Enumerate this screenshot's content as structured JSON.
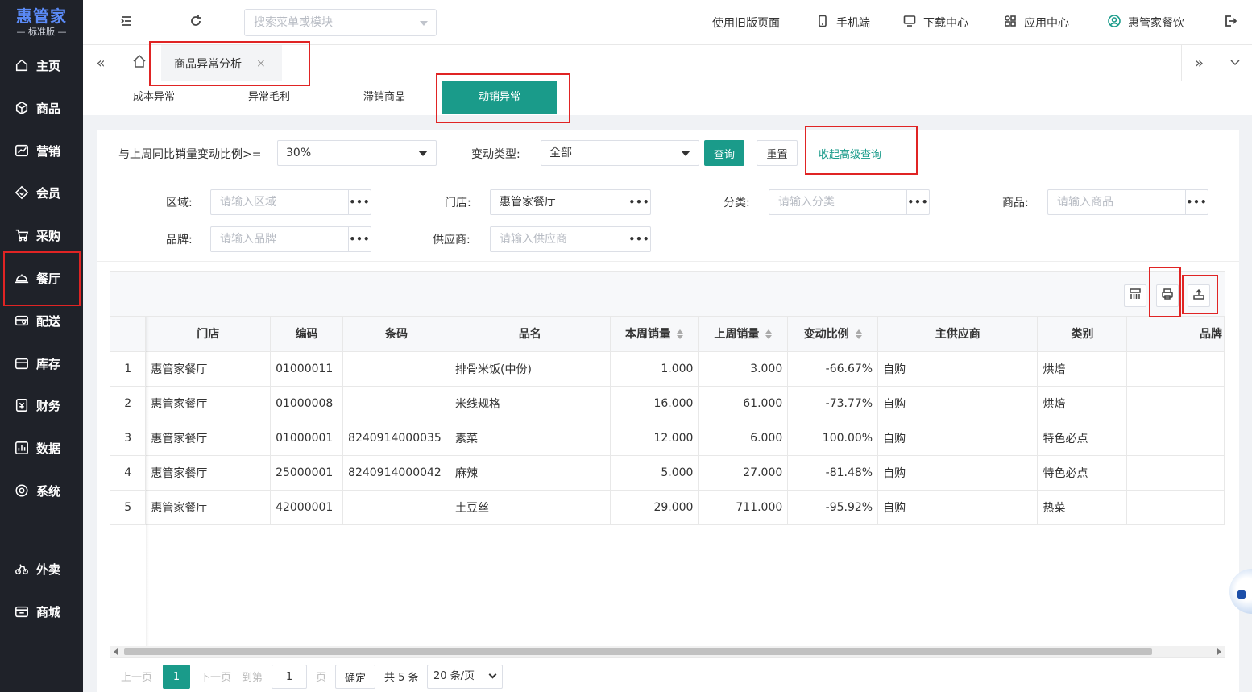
{
  "sidebar": {
    "logo": "惠管家",
    "edition": "标准版",
    "items": [
      {
        "label": "主页",
        "icon": "home-icon"
      },
      {
        "label": "商品",
        "icon": "cube-icon"
      },
      {
        "label": "营销",
        "icon": "chart-icon"
      },
      {
        "label": "会员",
        "icon": "diamond-icon"
      },
      {
        "label": "采购",
        "icon": "cart-icon"
      },
      {
        "label": "餐厅",
        "icon": "cloche-icon"
      },
      {
        "label": "配送",
        "icon": "truck-icon"
      },
      {
        "label": "库存",
        "icon": "box-icon"
      },
      {
        "label": "财务",
        "icon": "finance-icon"
      },
      {
        "label": "数据",
        "icon": "bar-chart-icon"
      },
      {
        "label": "系统",
        "icon": "settings-icon"
      },
      {
        "label": "外卖",
        "icon": "bike-icon"
      },
      {
        "label": "商城",
        "icon": "store-icon"
      }
    ]
  },
  "header": {
    "search_placeholder": "搜索菜单或模块",
    "old_page": "使用旧版页面",
    "mobile": "手机端",
    "download": "下载中心",
    "apps": "应用中心",
    "user": "惠管家餐饮"
  },
  "tabbar": {
    "active_tab": "商品异常分析",
    "close": "×"
  },
  "subtabs": [
    "成本异常",
    "异常毛利",
    "滞销商品",
    "动销异常"
  ],
  "filters": {
    "ratio_label": "与上周同比销量变动比例>=",
    "ratio_value": "30%",
    "type_label": "变动类型:",
    "type_value": "全部",
    "query": "查询",
    "reset": "重置",
    "collapse": "收起高级查询",
    "region_label": "区域:",
    "region_placeholder": "请输入区域",
    "store_label": "门店:",
    "store_value": "惠管家餐厅",
    "category_label": "分类:",
    "category_placeholder": "请输入分类",
    "product_label": "商品:",
    "product_placeholder": "请输入商品",
    "brand_label": "品牌:",
    "brand_placeholder": "请输入品牌",
    "supplier_label": "供应商:",
    "supplier_placeholder": "请输入供应商",
    "dots": "•••"
  },
  "table": {
    "columns": [
      "",
      "门店",
      "编码",
      "条码",
      "品名",
      "本周销量",
      "上周销量",
      "变动比例",
      "主供应商",
      "类别",
      "品牌"
    ],
    "rows": [
      [
        "1",
        "惠管家餐厅",
        "01000011",
        "",
        "排骨米饭(中份)",
        "1.000",
        "3.000",
        "-66.67%",
        "自购",
        "烘焙",
        ""
      ],
      [
        "2",
        "惠管家餐厅",
        "01000008",
        "",
        "米线规格",
        "16.000",
        "61.000",
        "-73.77%",
        "自购",
        "烘焙",
        ""
      ],
      [
        "3",
        "惠管家餐厅",
        "01000001",
        "8240914000035",
        "素菜",
        "12.000",
        "6.000",
        "100.00%",
        "自购",
        "特色必点",
        ""
      ],
      [
        "4",
        "惠管家餐厅",
        "25000001",
        "8240914000042",
        "麻辣",
        "5.000",
        "27.000",
        "-81.48%",
        "自购",
        "特色必点",
        ""
      ],
      [
        "5",
        "惠管家餐厅",
        "42000001",
        "",
        "土豆丝",
        "29.000",
        "711.000",
        "-95.92%",
        "自购",
        "热菜",
        ""
      ]
    ]
  },
  "pager": {
    "prev": "上一页",
    "current": "1",
    "next": "下一页",
    "goto": "到第",
    "page_input": "1",
    "page_unit": "页",
    "confirm": "确定",
    "total": "共 5 条",
    "page_size": "20 条/页"
  },
  "colors": {
    "sidebar_bg": "#1f2229",
    "accent": "#1a9b8a",
    "highlight_box": "#e02424",
    "logo": "#5b8bf7"
  }
}
